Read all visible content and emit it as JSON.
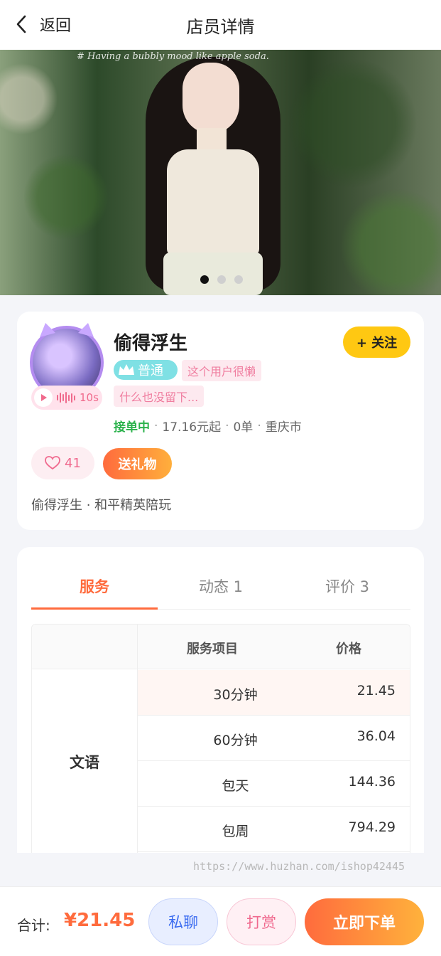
{
  "header": {
    "back_label": "返回",
    "title": "店员详情"
  },
  "banner": {
    "caption": "# Having a bubbly mood like apple soda.",
    "slide_count": 3,
    "active_slide": 1
  },
  "profile": {
    "name": "偷得浮生",
    "follow_label": "+ 关注",
    "voice_length": "10s",
    "level": "普通",
    "signature_line1": "这个用户很懒",
    "signature_line2": "什么也没留下...",
    "status": "接单中",
    "price_from": "17.16元起",
    "orders": "0单",
    "city": "重庆市",
    "likes": "41",
    "gift_label": "送礼物",
    "intro": "偷得浮生 · 和平精英陪玩"
  },
  "tabs": [
    {
      "label": "服务",
      "active": true
    },
    {
      "label": "动态 1",
      "active": false
    },
    {
      "label": "评价 3",
      "active": false
    }
  ],
  "service_table": {
    "header_item": "服务项目",
    "header_price": "价格",
    "category": "文语",
    "rows": [
      {
        "item": "30分钟",
        "price": "21.45"
      },
      {
        "item": "60分钟",
        "price": "36.04"
      },
      {
        "item": "包天",
        "price": "144.36"
      },
      {
        "item": "包周",
        "price": "794.29"
      }
    ]
  },
  "watermark": "https://www.huzhan.com/ishop42445",
  "footer": {
    "total_label": "合计:",
    "total_value": "¥21.45",
    "chat_label": "私聊",
    "tip_label": "打赏",
    "order_label": "立即下单"
  },
  "colors": {
    "accent": "#ff6b3d",
    "follow": "#ffc812",
    "status": "#2bb24c",
    "pink": "#f0698e"
  }
}
